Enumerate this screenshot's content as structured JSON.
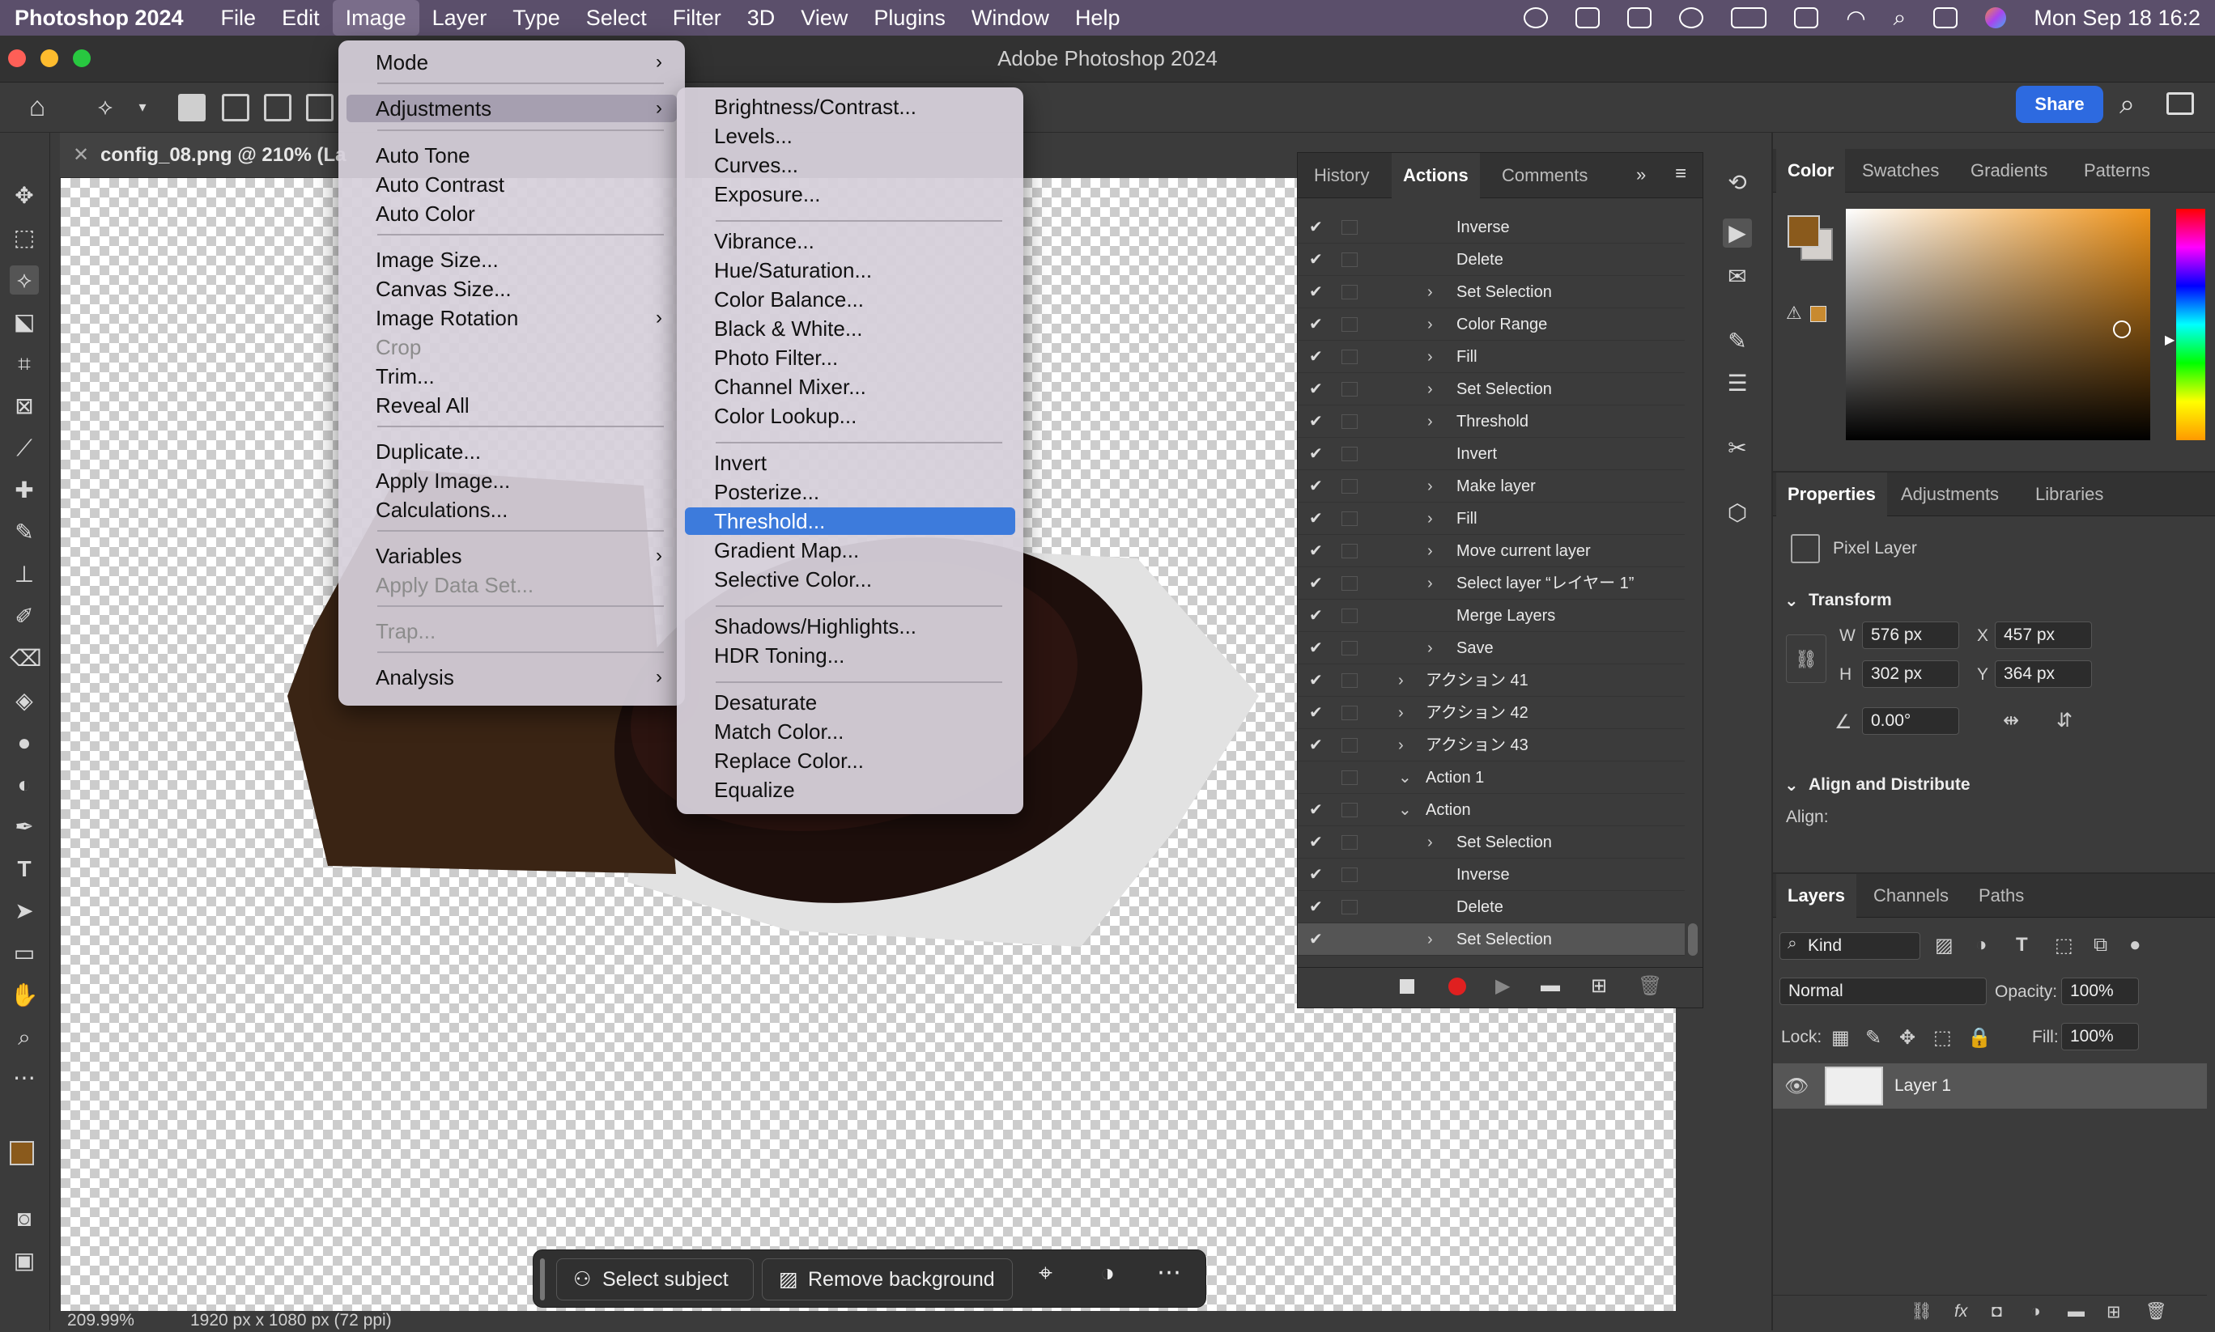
{
  "menubar": {
    "app": "Photoshop 2024",
    "items": [
      "File",
      "Edit",
      "Image",
      "Layer",
      "Type",
      "Select",
      "Filter",
      "3D",
      "View",
      "Plugins",
      "Window",
      "Help"
    ],
    "clock": "Mon Sep 18  16:2"
  },
  "window": {
    "title": "Adobe Photoshop 2024",
    "share": "Share"
  },
  "document": {
    "tab": "config_08.png @ 210% (La",
    "zoom": "209.99%",
    "size": "1920 px x 1080 px (72 ppi)"
  },
  "image_menu": {
    "mode": "Mode",
    "adjustments": "Adjustments",
    "auto_tone": "Auto Tone",
    "auto_contrast": "Auto Contrast",
    "auto_color": "Auto Color",
    "image_size": "Image Size...",
    "canvas_size": "Canvas Size...",
    "image_rotation": "Image Rotation",
    "crop": "Crop",
    "trim": "Trim...",
    "reveal_all": "Reveal All",
    "duplicate": "Duplicate...",
    "apply_image": "Apply Image...",
    "calculations": "Calculations...",
    "variables": "Variables",
    "apply_data_set": "Apply Data Set...",
    "trap": "Trap...",
    "analysis": "Analysis"
  },
  "adjustments_menu": {
    "brightness_contrast": "Brightness/Contrast...",
    "levels": "Levels...",
    "curves": "Curves...",
    "exposure": "Exposure...",
    "vibrance": "Vibrance...",
    "hue_saturation": "Hue/Saturation...",
    "color_balance": "Color Balance...",
    "black_white": "Black & White...",
    "photo_filter": "Photo Filter...",
    "channel_mixer": "Channel Mixer...",
    "color_lookup": "Color Lookup...",
    "invert": "Invert",
    "posterize": "Posterize...",
    "threshold": "Threshold...",
    "gradient_map": "Gradient Map...",
    "selective_color": "Selective Color...",
    "shadows_highlights": "Shadows/Highlights...",
    "hdr_toning": "HDR Toning...",
    "desaturate": "Desaturate",
    "match_color": "Match Color...",
    "replace_color": "Replace Color...",
    "equalize": "Equalize"
  },
  "actions_panel": {
    "tabs": [
      "History",
      "Actions",
      "Comments"
    ],
    "rows": [
      {
        "label": "Inverse",
        "checked": true
      },
      {
        "label": "Delete",
        "checked": true
      },
      {
        "label": "Set Selection",
        "checked": true
      },
      {
        "label": "Color Range",
        "checked": true
      },
      {
        "label": "Fill",
        "checked": true
      },
      {
        "label": "Set Selection",
        "checked": true
      },
      {
        "label": "Threshold",
        "checked": true
      },
      {
        "label": "Invert",
        "checked": true
      },
      {
        "label": "Make layer",
        "checked": true
      },
      {
        "label": "Fill",
        "checked": true
      },
      {
        "label": "Move current layer",
        "checked": true
      },
      {
        "label": "Select layer “レイヤー 1”",
        "checked": true
      },
      {
        "label": "Merge Layers",
        "checked": true
      },
      {
        "label": "Save",
        "checked": true
      },
      {
        "label": "アクション 41",
        "checked": true
      },
      {
        "label": "アクション 42",
        "checked": true
      },
      {
        "label": "アクション 43",
        "checked": true
      },
      {
        "label": "Action 1",
        "checked": false
      },
      {
        "label": "Action",
        "checked": true
      },
      {
        "label": "Set Selection",
        "checked": true
      },
      {
        "label": "Inverse",
        "checked": true
      },
      {
        "label": "Delete",
        "checked": true
      },
      {
        "label": "Set Selection",
        "checked": true
      }
    ]
  },
  "color_panel": {
    "tabs": [
      "Color",
      "Swatches",
      "Gradients",
      "Patterns"
    ],
    "fg": "#8a5a1c"
  },
  "properties": {
    "tabs": [
      "Properties",
      "Adjustments",
      "Libraries"
    ],
    "kind": "Pixel Layer",
    "transform": "Transform",
    "w_label": "W",
    "w": "576 px",
    "x_label": "X",
    "x": "457 px",
    "h_label": "H",
    "h": "302 px",
    "y_label": "Y",
    "y": "364 px",
    "angle": "0.00°",
    "align": "Align and Distribute",
    "align_label": "Align:"
  },
  "layers": {
    "tabs": [
      "Layers",
      "Channels",
      "Paths"
    ],
    "kind": "Kind",
    "blend": "Normal",
    "opacity_label": "Opacity:",
    "opacity": "100%",
    "lock_label": "Lock:",
    "fill_label": "Fill:",
    "fill": "100%",
    "layer_name": "Layer 1"
  },
  "ctxbar": {
    "select_subject": "Select subject",
    "remove_background": "Remove background"
  }
}
